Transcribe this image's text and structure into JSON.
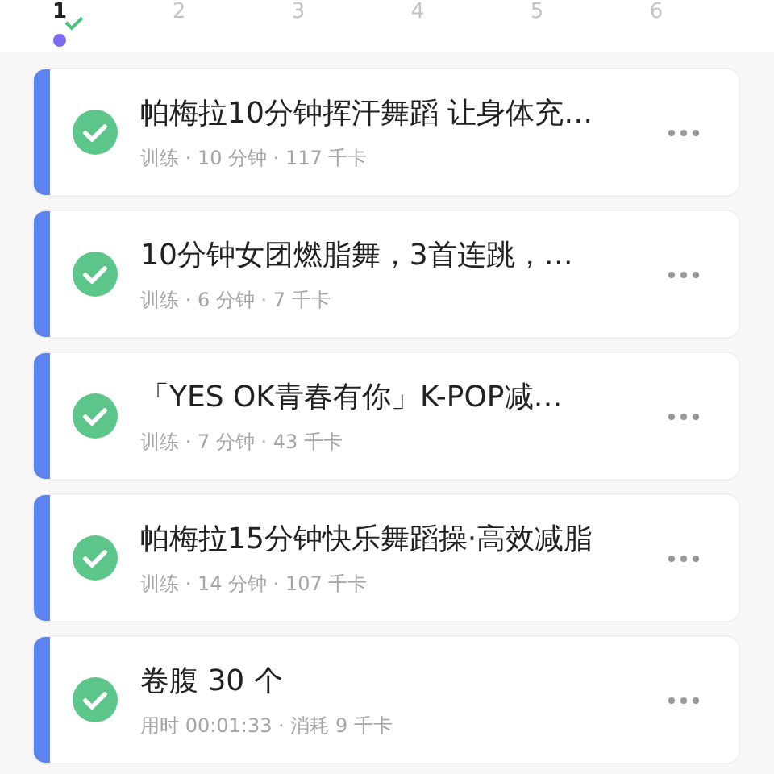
{
  "days": [
    {
      "label": "1",
      "selected": true,
      "completed": true,
      "has_record": true
    },
    {
      "label": "2",
      "selected": false,
      "completed": false,
      "has_record": false
    },
    {
      "label": "3",
      "selected": false,
      "completed": false,
      "has_record": false
    },
    {
      "label": "4",
      "selected": false,
      "completed": false,
      "has_record": false
    },
    {
      "label": "5",
      "selected": false,
      "completed": false,
      "has_record": false
    },
    {
      "label": "6",
      "selected": false,
      "completed": false,
      "has_record": false
    }
  ],
  "records": [
    {
      "title": "帕梅拉10分钟挥汗舞蹈 让身体充…",
      "meta": "训练 · 10 分钟 · 117 千卡",
      "completed": true
    },
    {
      "title": "10分钟女团燃脂舞，3首连跳，…",
      "meta": "训练 · 6 分钟 · 7 千卡",
      "completed": true
    },
    {
      "title": "「YES OK青春有你」K-POP减…",
      "meta": "训练 · 7 分钟 · 43 千卡",
      "completed": true
    },
    {
      "title": "帕梅拉15分钟快乐舞蹈操·高效减脂",
      "meta": "训练 · 14 分钟 · 107 千卡",
      "completed": true
    },
    {
      "title": "卷腹 30 个",
      "meta": "用时 00:01:33 · 消耗 9 千卡",
      "completed": true
    }
  ]
}
